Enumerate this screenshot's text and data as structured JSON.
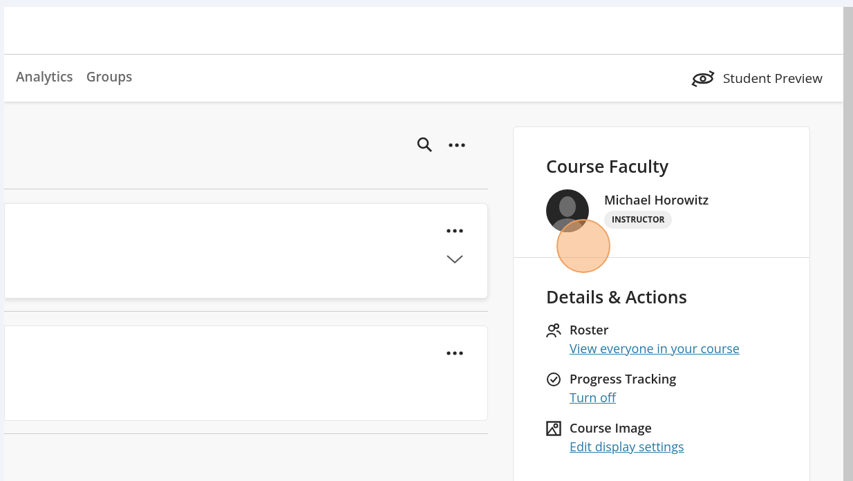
{
  "nav_tabs": [
    {
      "label": "Analytics",
      "selected": false
    },
    {
      "label": "Groups",
      "selected": false
    }
  ],
  "student_preview": {
    "label": "Student Preview"
  },
  "content_items": [
    {
      "kind": "expandable"
    },
    {
      "kind": "plain"
    }
  ],
  "course_faculty": {
    "title": "Course Faculty",
    "members": [
      {
        "name": "Michael Horowitz",
        "role": "INSTRUCTOR"
      }
    ]
  },
  "details_actions": {
    "title": "Details & Actions",
    "items": [
      {
        "kind": "roster",
        "label": "Roster",
        "link": "View everyone in your course"
      },
      {
        "kind": "progress",
        "label": "Progress Tracking",
        "link": "Turn off"
      },
      {
        "kind": "image",
        "label": "Course Image",
        "link": "Edit display settings"
      }
    ]
  }
}
